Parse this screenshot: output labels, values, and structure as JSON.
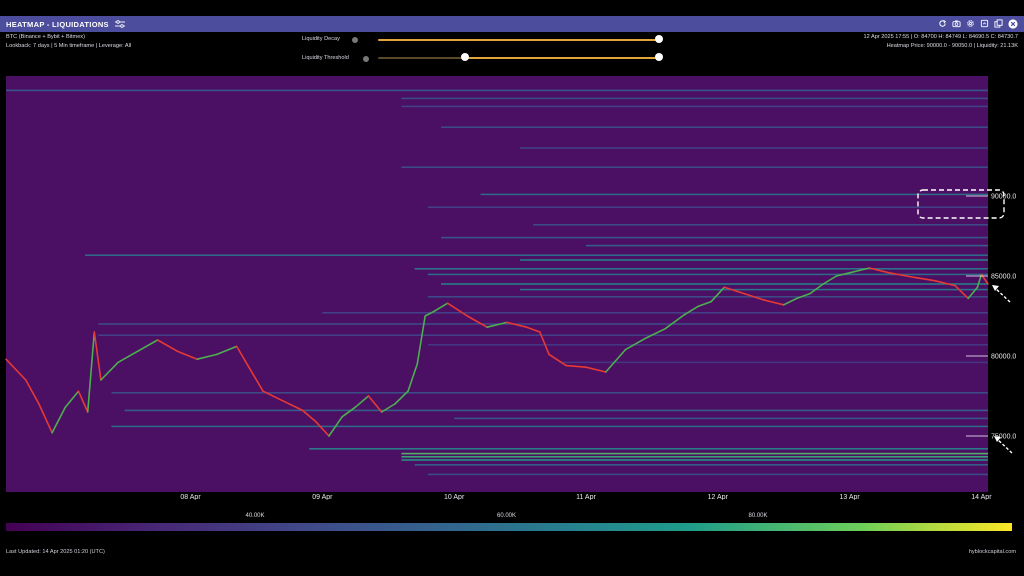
{
  "window": {
    "title": "HEATMAP - LIQUIDATIONS"
  },
  "info_left": {
    "line1": "BTC (Binance + Bybit + Bitmex)",
    "line2": "Lookback: 7 days | 5 Min timeframe | Leverage: All"
  },
  "controls": {
    "decay_label": "Liquidity Decay",
    "threshold_label": "Liquidity Threshold",
    "decay_value": 1.0,
    "threshold_range": [
      0.3,
      1.0
    ]
  },
  "info_right": {
    "line1": "12 Apr 2025 17:55 | O: 84700 H: 84749 L: 84690.5 C: 84730.7",
    "line2": "Heatmap Price: 90000.0 - 90050.0 | Liquidity: 21.13K"
  },
  "footer": {
    "updated": "Last Updated: 14 Apr 2025 01:20 (UTC)",
    "brand": "hyblockcapital.com"
  },
  "colors": {
    "background": "#4b0f63",
    "candle_up": "#4caf50",
    "candle_down": "#e53935",
    "titlebar": "#4c4d9c"
  },
  "icons": [
    "settings-icon",
    "refresh-icon",
    "camera-icon",
    "gear-icon",
    "export-icon",
    "copy-icon",
    "close-icon"
  ],
  "chart_data": {
    "type": "heatmap",
    "x_tick_labels": [
      "08 Apr",
      "09 Apr",
      "10 Apr",
      "11 Apr",
      "12 Apr",
      "13 Apr",
      "14 Apr"
    ],
    "y_tick_labels": [
      "90000.0",
      "85000.0",
      "80000.0",
      "75000.0"
    ],
    "y_ticks": [
      90000,
      85000,
      80000,
      75000
    ],
    "ylim": [
      71500,
      97500
    ],
    "xlim": [
      6.6,
      14.05
    ],
    "colorbar": {
      "tick_labels": [
        "40.00K",
        "60.00K",
        "80.00K"
      ],
      "ticks": [
        40000,
        60000,
        80000
      ],
      "range": [
        20000,
        100000
      ]
    },
    "price_series": [
      {
        "t": 6.6,
        "p": 79800
      },
      {
        "t": 6.75,
        "p": 78500
      },
      {
        "t": 6.85,
        "p": 77000
      },
      {
        "t": 6.95,
        "p": 75200
      },
      {
        "t": 7.05,
        "p": 76800
      },
      {
        "t": 7.15,
        "p": 77800
      },
      {
        "t": 7.22,
        "p": 76500
      },
      {
        "t": 7.27,
        "p": 81500
      },
      {
        "t": 7.32,
        "p": 78500
      },
      {
        "t": 7.45,
        "p": 79600
      },
      {
        "t": 7.6,
        "p": 80300
      },
      {
        "t": 7.75,
        "p": 81000
      },
      {
        "t": 7.9,
        "p": 80300
      },
      {
        "t": 8.05,
        "p": 79800
      },
      {
        "t": 8.2,
        "p": 80100
      },
      {
        "t": 8.35,
        "p": 80600
      },
      {
        "t": 8.45,
        "p": 79200
      },
      {
        "t": 8.55,
        "p": 77800
      },
      {
        "t": 8.7,
        "p": 77200
      },
      {
        "t": 8.85,
        "p": 76600
      },
      {
        "t": 8.95,
        "p": 75900
      },
      {
        "t": 9.05,
        "p": 75000
      },
      {
        "t": 9.15,
        "p": 76200
      },
      {
        "t": 9.25,
        "p": 76800
      },
      {
        "t": 9.35,
        "p": 77500
      },
      {
        "t": 9.45,
        "p": 76500
      },
      {
        "t": 9.55,
        "p": 77000
      },
      {
        "t": 9.65,
        "p": 77800
      },
      {
        "t": 9.72,
        "p": 79500
      },
      {
        "t": 9.78,
        "p": 82500
      },
      {
        "t": 9.85,
        "p": 82800
      },
      {
        "t": 9.95,
        "p": 83300
      },
      {
        "t": 10.1,
        "p": 82500
      },
      {
        "t": 10.25,
        "p": 81800
      },
      {
        "t": 10.4,
        "p": 82100
      },
      {
        "t": 10.55,
        "p": 81800
      },
      {
        "t": 10.65,
        "p": 81500
      },
      {
        "t": 10.72,
        "p": 80100
      },
      {
        "t": 10.85,
        "p": 79400
      },
      {
        "t": 11.0,
        "p": 79300
      },
      {
        "t": 11.15,
        "p": 79000
      },
      {
        "t": 11.3,
        "p": 80400
      },
      {
        "t": 11.45,
        "p": 81100
      },
      {
        "t": 11.6,
        "p": 81700
      },
      {
        "t": 11.75,
        "p": 82600
      },
      {
        "t": 11.85,
        "p": 83100
      },
      {
        "t": 11.95,
        "p": 83400
      },
      {
        "t": 12.05,
        "p": 84300
      },
      {
        "t": 12.2,
        "p": 83900
      },
      {
        "t": 12.35,
        "p": 83500
      },
      {
        "t": 12.5,
        "p": 83200
      },
      {
        "t": 12.6,
        "p": 83600
      },
      {
        "t": 12.7,
        "p": 83900
      },
      {
        "t": 12.8,
        "p": 84500
      },
      {
        "t": 12.9,
        "p": 85000
      },
      {
        "t": 13.0,
        "p": 85200
      },
      {
        "t": 13.15,
        "p": 85500
      },
      {
        "t": 13.3,
        "p": 85200
      },
      {
        "t": 13.5,
        "p": 84900
      },
      {
        "t": 13.65,
        "p": 84700
      },
      {
        "t": 13.8,
        "p": 84400
      },
      {
        "t": 13.9,
        "p": 83600
      },
      {
        "t": 13.97,
        "p": 84300
      },
      {
        "t": 14.0,
        "p": 85100
      },
      {
        "t": 14.05,
        "p": 84500
      }
    ],
    "liquidity_levels": [
      {
        "price": 96600,
        "t_start": 6.6,
        "intensity": 0.35
      },
      {
        "price": 96100,
        "t_start": 9.6,
        "intensity": 0.3
      },
      {
        "price": 95600,
        "t_start": 9.6,
        "intensity": 0.25
      },
      {
        "price": 94300,
        "t_start": 9.9,
        "intensity": 0.3
      },
      {
        "price": 93000,
        "t_start": 10.5,
        "intensity": 0.25
      },
      {
        "price": 91800,
        "t_start": 9.6,
        "intensity": 0.3
      },
      {
        "price": 90100,
        "t_start": 10.2,
        "intensity": 0.45
      },
      {
        "price": 89300,
        "t_start": 9.8,
        "intensity": 0.25
      },
      {
        "price": 88200,
        "t_start": 10.6,
        "intensity": 0.3
      },
      {
        "price": 87400,
        "t_start": 9.9,
        "intensity": 0.35
      },
      {
        "price": 86900,
        "t_start": 11.0,
        "intensity": 0.4
      },
      {
        "price": 86300,
        "t_start": 7.2,
        "intensity": 0.45
      },
      {
        "price": 86000,
        "t_start": 10.5,
        "intensity": 0.55
      },
      {
        "price": 85450,
        "t_start": 9.7,
        "intensity": 0.5
      },
      {
        "price": 85100,
        "t_start": 9.8,
        "intensity": 0.45
      },
      {
        "price": 84500,
        "t_start": 9.9,
        "intensity": 0.55
      },
      {
        "price": 84150,
        "t_start": 10.5,
        "intensity": 0.5
      },
      {
        "price": 83700,
        "t_start": 9.8,
        "intensity": 0.3
      },
      {
        "price": 82700,
        "t_start": 9.0,
        "intensity": 0.25
      },
      {
        "price": 82000,
        "t_start": 7.3,
        "intensity": 0.3
      },
      {
        "price": 81300,
        "t_start": 7.3,
        "intensity": 0.25
      },
      {
        "price": 80700,
        "t_start": 9.8,
        "intensity": 0.2
      },
      {
        "price": 79600,
        "t_start": 10.8,
        "intensity": 0.2
      },
      {
        "price": 77700,
        "t_start": 7.4,
        "intensity": 0.3
      },
      {
        "price": 76600,
        "t_start": 7.5,
        "intensity": 0.4
      },
      {
        "price": 76100,
        "t_start": 10.0,
        "intensity": 0.35
      },
      {
        "price": 75600,
        "t_start": 7.4,
        "intensity": 0.45
      },
      {
        "price": 74200,
        "t_start": 8.9,
        "intensity": 0.55
      },
      {
        "price": 73900,
        "t_start": 9.6,
        "intensity": 0.8
      },
      {
        "price": 73700,
        "t_start": 9.6,
        "intensity": 0.75
      },
      {
        "price": 73500,
        "t_start": 9.6,
        "intensity": 0.65
      },
      {
        "price": 73200,
        "t_start": 9.7,
        "intensity": 0.4
      },
      {
        "price": 72600,
        "t_start": 9.8,
        "intensity": 0.3
      }
    ]
  }
}
